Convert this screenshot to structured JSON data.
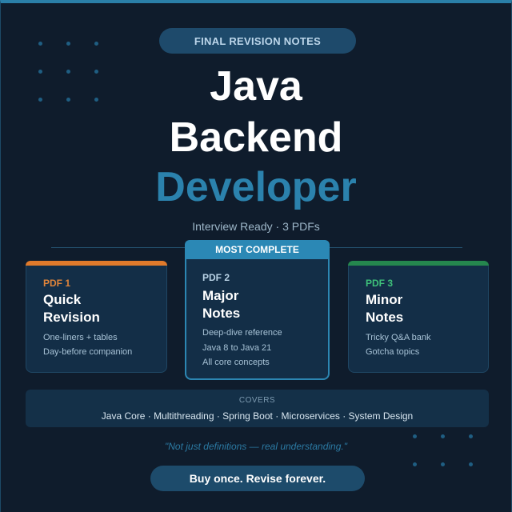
{
  "header": {
    "tag": "FINAL REVISION NOTES",
    "title_line1": "Java",
    "title_line2": "Backend",
    "title_line3": "Developer",
    "subtitle": "Interview Ready · 3 PDFs"
  },
  "cards": [
    {
      "label": "PDF 1",
      "title_line1": "Quick",
      "title_line2": "Revision",
      "lines": [
        "One-liners + tables",
        "Day-before companion"
      ],
      "accent": "#e07a2b"
    },
    {
      "badge": "MOST COMPLETE",
      "label": "PDF 2",
      "title_line1": "Major",
      "title_line2": "Notes",
      "lines": [
        "Deep-dive reference",
        "Java 8 to Java 21",
        "All core concepts"
      ],
      "accent": "#2b88b5"
    },
    {
      "label": "PDF 3",
      "title_line1": "Minor",
      "title_line2": "Notes",
      "lines": [
        "Tricky Q&A bank",
        "Gotcha topics"
      ],
      "accent": "#25874e"
    }
  ],
  "covers": {
    "label": "COVERS",
    "topics": "Java Core · Multithreading · Spring Boot · Microservices · System Design"
  },
  "quote": "\"Not just definitions — real understanding.\"",
  "cta": "Buy once. Revise forever."
}
